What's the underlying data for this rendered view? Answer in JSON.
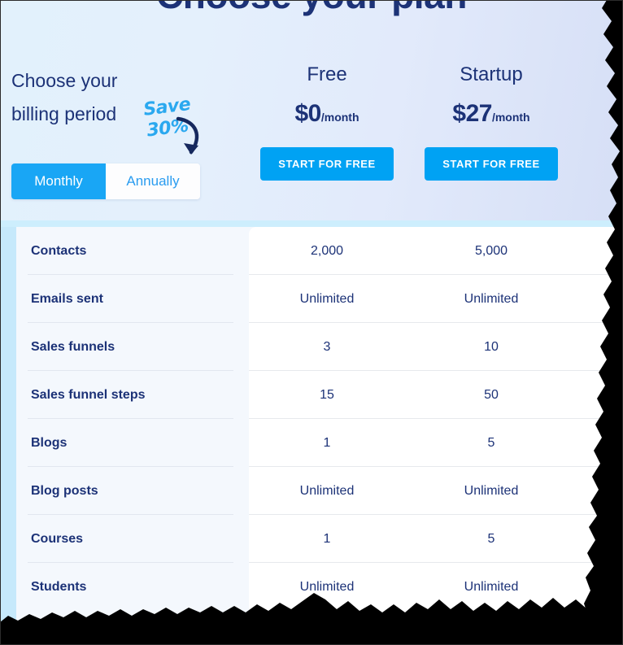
{
  "page": {
    "title": "Choose your plan",
    "billing_label_line1": "Choose your",
    "billing_label_line2": "billing period"
  },
  "promo": {
    "save_line1": "Save",
    "save_line2": "30%",
    "arrow_icon": "curved-arrow-down-left-icon"
  },
  "billing_toggle": {
    "options": [
      {
        "label": "Monthly",
        "active": true
      },
      {
        "label": "Annually",
        "active": false
      }
    ]
  },
  "plans": [
    {
      "name": "Free",
      "price_amount": "$0",
      "price_period": "/month",
      "cta_label": "START FOR FREE"
    },
    {
      "name": "Startup",
      "price_amount": "$27",
      "price_period": "/month",
      "cta_label": "START FOR FREE"
    },
    {
      "name": "",
      "price_amount": "",
      "price_period": "",
      "cta_label": ""
    }
  ],
  "features": [
    {
      "label": "Contacts",
      "values": [
        "2,000",
        "5,000",
        ""
      ]
    },
    {
      "label": "Emails sent",
      "values": [
        "Unlimited",
        "Unlimited",
        ""
      ]
    },
    {
      "label": "Sales funnels",
      "values": [
        "3",
        "10",
        ""
      ]
    },
    {
      "label": "Sales funnel steps",
      "values": [
        "15",
        "50",
        ""
      ]
    },
    {
      "label": "Blogs",
      "values": [
        "1",
        "5",
        ""
      ]
    },
    {
      "label": "Blog posts",
      "values": [
        "Unlimited",
        "Unlimited",
        ""
      ]
    },
    {
      "label": "Courses",
      "values": [
        "1",
        "5",
        ""
      ]
    },
    {
      "label": "Students",
      "values": [
        "Unlimited",
        "Unlimited",
        ""
      ]
    }
  ],
  "colors": {
    "brand_blue": "#00a2f3",
    "toggle_active_blue": "#19a6f5",
    "navy_text": "#1c3277",
    "promo_blue": "#2aa8ef",
    "table_bg": "#f4f8fd",
    "panel_white": "#ffffff",
    "strip_cyan": "#cdeefd",
    "left_edge_blue": "#c6e9fb"
  }
}
